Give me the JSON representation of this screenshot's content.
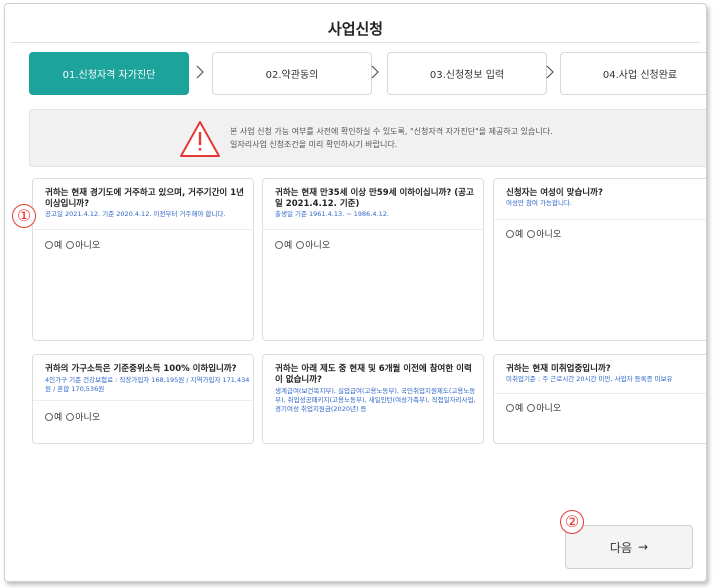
{
  "page": {
    "title": "사업신청"
  },
  "steps": [
    {
      "label": "01.신청자격 자가진단",
      "active": true
    },
    {
      "label": "02.약관동의",
      "active": false
    },
    {
      "label": "03.신청정보 입력",
      "active": false
    },
    {
      "label": "04.사업 신청완료",
      "active": false
    }
  ],
  "notice": {
    "line1": "본 사업 신청 가능 여부를 사전에 확인하실 수 있도록, \"신청자격 자가진단\"을 제공하고 있습니다.",
    "line2": "일자리사업 신청조건을 미리 확인하시기 바랍니다.",
    "icon": "warning-triangle-icon"
  },
  "questions": [
    {
      "question": "귀하는 현재 경기도에 거주하고 있으며, 거주기간이 1년 이상입니까?",
      "note": "공고일 2021.4.12. 기준 2020.4.12. 이전부터 거주해야 합니다.",
      "yes": "예",
      "no": "아니오"
    },
    {
      "question": "귀하는 현재 만35세 이상 만59세 이하이십니까? (공고일 2021.4.12. 기준)",
      "note": "출생일 기준 1961.4.13. ~ 1986.4.12.",
      "yes": "예",
      "no": "아니오"
    },
    {
      "question": "신청자는 여성이 맞습니까?",
      "note": "여성만 참여 가능합니다.",
      "yes": "예",
      "no": "아니오"
    },
    {
      "question": "귀하의 가구소득은 기준중위소득 100% 이하입니까?",
      "note": "4인가구 기준 건강보험료 : 직장가입자 168,195원 / 지역가입자 171,434원 / 혼합 170,536원",
      "yes": "예",
      "no": "아니오"
    },
    {
      "question": "귀하는 아래 제도 중 현재 및 6개월 이전에 참여한 이력이 없습니까?",
      "note": "생계급여(보건복지부), 실업급여(고용노동부), 국민취업지원제도(고용노동부), 취업성공패키지(고용노동부), 새일인턴(여성가족부), 직접일자리사업, 경기여성 취업지원금(2020년) 등",
      "yes": "예",
      "no": "아니오"
    },
    {
      "question": "귀하는 현재 미취업중입니까?",
      "note": "미취업기준 : 주 근로시간 20시간 미만, 사업자 등록증 미보유",
      "yes": "예",
      "no": "아니오"
    }
  ],
  "markers": {
    "m1": "①",
    "m2": "②"
  },
  "next_button": {
    "label": "다음",
    "arrow": "→"
  },
  "colors": {
    "accent": "#1ba39c",
    "link": "#2f66c9",
    "marker": "#e53935"
  }
}
